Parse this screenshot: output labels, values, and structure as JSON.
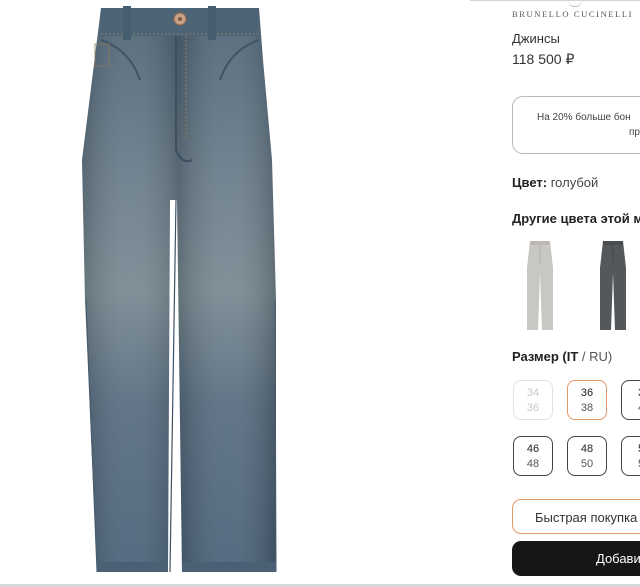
{
  "product": {
    "brand": "BRUNELLO CUCINELLI",
    "title": "Джинсы",
    "price": "118 500 ₽",
    "bonus_line1": "На 20% больше бон",
    "bonus_line2": "пр"
  },
  "color": {
    "label": "Цвет",
    "sep": ": ",
    "value": "голубой"
  },
  "other_colors": {
    "title": "Другие цвета этой м",
    "items": [
      {
        "icon": "light-grey-jeans-thumbnail",
        "color": "#c9c7c4"
      },
      {
        "icon": "dark-grey-jeans-thumbnail",
        "color": "#55585a"
      }
    ]
  },
  "sizes": {
    "title_bold": "Размер (IT",
    "title_rest": " / RU)",
    "items": [
      {
        "it": "34",
        "ru": "36",
        "state": "disabled"
      },
      {
        "it": "36",
        "ru": "38",
        "state": "selected"
      },
      {
        "it": "3",
        "ru": "4",
        "state": "normal"
      },
      {
        "it": "46",
        "ru": "48",
        "state": "normal"
      },
      {
        "it": "48",
        "ru": "50",
        "state": "normal"
      },
      {
        "it": "5",
        "ru": "5",
        "state": "normal"
      }
    ]
  },
  "buttons": {
    "quick_buy": "Быстрая покупка",
    "add_to_cart": "Добави"
  },
  "theme": {
    "accent": "#e39a69",
    "primary_button": "#161616",
    "denim": "#55697c"
  }
}
